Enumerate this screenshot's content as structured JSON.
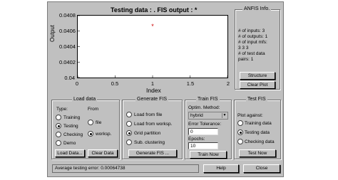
{
  "plot": {
    "title": "Testing data :  .   FIS output : *",
    "ylabel": "Output",
    "xlabel": "Index",
    "yticks": [
      "0.0408",
      "0.0406",
      "0.0404",
      "0.0402",
      "0.04"
    ],
    "xticks": [
      "0",
      "0.5",
      "1",
      "1.5",
      "2"
    ],
    "marker": "*"
  },
  "chart_data": {
    "type": "scatter",
    "title": "Testing data :  .   FIS output : *",
    "xlabel": "Index",
    "ylabel": "Output",
    "xlim": [
      0,
      2
    ],
    "ylim": [
      0.04,
      0.0408
    ],
    "series": [
      {
        "name": "FIS output",
        "x": [
          1
        ],
        "y": [
          0.04066
        ],
        "marker": "*",
        "color": "#cc0000"
      }
    ]
  },
  "anfis_info": {
    "title": "ANFIS Info.",
    "lines": [
      "# of inputs: 3",
      "# of outputs: 1",
      "# of input mfs:",
      "3  3  3",
      "# of test data",
      "pairs: 1"
    ],
    "structure_button": "Structure",
    "clear_plot_button": "Clear Plot"
  },
  "load_data": {
    "title": "Load data",
    "type_label": "Type:",
    "from_label": "From",
    "types": [
      {
        "label": "Training",
        "selected": false
      },
      {
        "label": "Testing",
        "selected": true
      },
      {
        "label": "Checking",
        "selected": false
      },
      {
        "label": "Demo",
        "selected": false
      }
    ],
    "from": [
      {
        "label": "file",
        "selected": false
      },
      {
        "label": "worksp.",
        "selected": true
      }
    ],
    "load_button": "Load Data...",
    "clear_button": "Clear Data"
  },
  "generate_fis": {
    "title": "Generate FIS",
    "options": [
      {
        "label": "Load from file",
        "selected": false
      },
      {
        "label": "Load from worksp.",
        "selected": false
      },
      {
        "label": "Grid partition",
        "selected": true
      },
      {
        "label": "Sub. clustering",
        "selected": false
      }
    ],
    "button": "Generate FIS ..."
  },
  "train_fis": {
    "title": "Train FIS",
    "optim_label": "Optim. Method:",
    "optim_value": "hybrid",
    "tolerance_label": "Error Tolerance:",
    "tolerance_value": "0",
    "epochs_label": "Epochs:",
    "epochs_value": "10",
    "button": "Train Now"
  },
  "test_fis": {
    "title": "Test FIS",
    "plot_against": "Plot against:",
    "options": [
      {
        "label": "Training data",
        "selected": false
      },
      {
        "label": "Testing data",
        "selected": true
      },
      {
        "label": "Checking data",
        "selected": false
      }
    ],
    "button": "Test Now"
  },
  "status": {
    "text": "Average testing error: 0.00064738"
  },
  "footer": {
    "help_button": "Help",
    "close_button": "Close"
  },
  "colors": {
    "window_bg": "#c0c0c0",
    "marker": "#cc0000"
  }
}
